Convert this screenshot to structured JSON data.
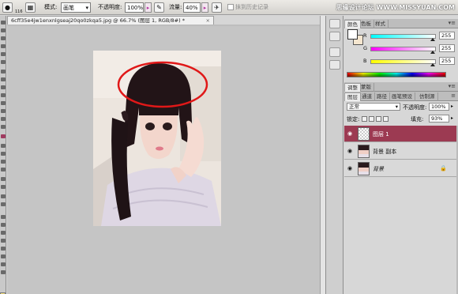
{
  "options_bar": {
    "brush_size": "116",
    "mode_label": "模式:",
    "mode_value": "画笔",
    "opacity_label": "不透明度:",
    "opacity_value": "100%",
    "flow_label": "流量:",
    "flow_value": "40%",
    "history_checkbox_label": "抹到历史记录",
    "watermark": "思缘设计论坛 WWW.MISSYUAN.COM"
  },
  "document": {
    "tab_title": "6cff35e4jw1enxnlgseaj20qo0zkqa5.jpg @ 66.7% (图层 1, RGB/8#) *",
    "close_glyph": "×"
  },
  "annotation": {
    "color": "#e01818",
    "shape": "ellipse"
  },
  "color_panel": {
    "tabs": [
      "颜色",
      "色板",
      "样式"
    ],
    "tabs2": [
      "调整",
      "蒙版"
    ],
    "channels": [
      {
        "label": "R",
        "value": "255"
      },
      {
        "label": "G",
        "value": "255"
      },
      {
        "label": "B",
        "value": "255"
      }
    ],
    "fg_color": "#ffffff",
    "bg_color": "#f5e6cf"
  },
  "adjust_panel": {
    "tabs": [
      "调整",
      "蒙版"
    ]
  },
  "layers_panel": {
    "tabs": [
      "图层",
      "通道",
      "路径",
      "画笔预设",
      "仿制源"
    ],
    "blend_mode": "正常",
    "opacity_label": "不透明度:",
    "opacity_value": "100%",
    "lock_label": "锁定:",
    "fill_label": "填充:",
    "fill_value": "93%",
    "layers": [
      {
        "name": "图层 1",
        "selected": true,
        "lock": ""
      },
      {
        "name": "背景 副本",
        "selected": false,
        "lock": ""
      },
      {
        "name": "背景",
        "selected": false,
        "lock": "🔒"
      }
    ],
    "selected_color": "#9c3a52"
  }
}
